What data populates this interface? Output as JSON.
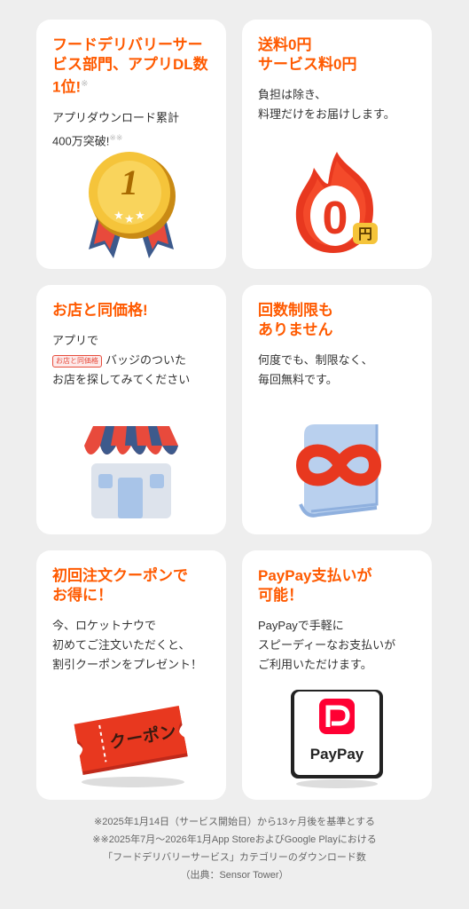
{
  "cards": [
    {
      "title": "フードデリバリーサー\nビス部門、アプリDL数\n1位!",
      "title_note": "※",
      "body": "アプリダウンロード累計\n400万突破!",
      "body_note": "※※",
      "icon": "medal-icon",
      "medal_text": "1"
    },
    {
      "title": "送料0円\nサービス料0円",
      "body": "負担は除き、\n料理だけをお届けします。",
      "icon": "zero-flame-icon",
      "flame_text": "0",
      "flame_unit": "円"
    },
    {
      "title": "お店と同価格!",
      "body_pre": "アプリで",
      "badge": "お店と同価格",
      "body_post": "バッジのついた\nお店を探してみてください",
      "icon": "shop-icon"
    },
    {
      "title": "回数制限も\n ありません",
      "body": "何度でも、制限なく、\n毎回無料です。",
      "icon": "infinity-icon"
    },
    {
      "title": "初回注文クーポンで\nお得に！",
      "body": "今、ロケットナウで\n初めてご注文いただくと、\n割引クーポンをプレゼント！",
      "icon": "coupon-icon",
      "coupon_text": "クーポン"
    },
    {
      "title": "PayPay支払いが\n可能！",
      "body": "PayPayで手軽に\nスピーディーなお支払いが\nご利用いただけます。",
      "icon": "paypay-logo-icon",
      "logo_text": "PayPay"
    }
  ],
  "footnotes": [
    "※2025年1月14日（サービス開始日）から13ヶ月後を基準とする",
    "※※2025年7月〜2026年1月App StoreおよびGoogle Playにおける",
    "「フードデリバリーサービス」カテゴリーのダウンロード数",
    "（出典：Sensor Tower）"
  ],
  "colors": {
    "accent": "#ff5a00",
    "background": "#eeeeee",
    "card": "#ffffff",
    "paypay_red": "#ff0033"
  }
}
